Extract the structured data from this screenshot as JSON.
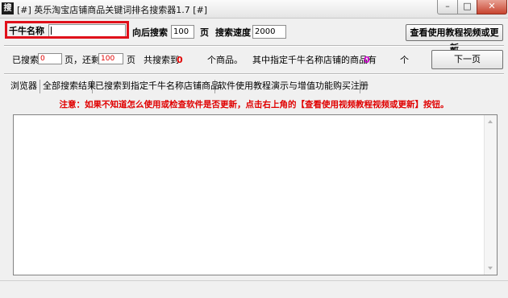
{
  "window": {
    "icon_glyph": "搜",
    "title": "[#] 英乐淘宝店铺商品关键词排名搜索器1.7 [#]",
    "minimize_glyph": "–",
    "maximize_glyph": "□",
    "close_glyph": "✕"
  },
  "search_row": {
    "shop_label": "千牛名称",
    "shop_value": "",
    "pages_label": "向后搜索",
    "pages_value": "100",
    "pages_unit": "页",
    "speed_label": "搜索速度",
    "speed_value": "2000",
    "tutorial_button": "查看使用教程视频或更新"
  },
  "status_row": {
    "searched_label": "已搜索",
    "searched_value": "0",
    "remaining_label": "页，还剩",
    "remaining_value": "100",
    "remaining_unit": "页",
    "found_label": "共搜索到",
    "found_count": "0",
    "found_unit": "个商品。",
    "shop_items_label": "其中指定千牛名称店铺的商品有",
    "shop_items_count": "0",
    "shop_items_unit": "个",
    "next_page_button": "下一页"
  },
  "tabs": [
    "浏览器",
    "全部搜索结果",
    "已搜索到指定千牛名称店铺商品",
    "软件使用教程演示与增值功能购买注册"
  ],
  "notice": "注意：如果不知道怎么使用或检查软件是否更新，点击右上角的【查看使用视频教程视频或更新】按钮。",
  "colors": {
    "highlight_box": "#e0101a",
    "notice_text": "#e00000",
    "found_count": "#e00000",
    "shop_count": "#cc00cc"
  }
}
